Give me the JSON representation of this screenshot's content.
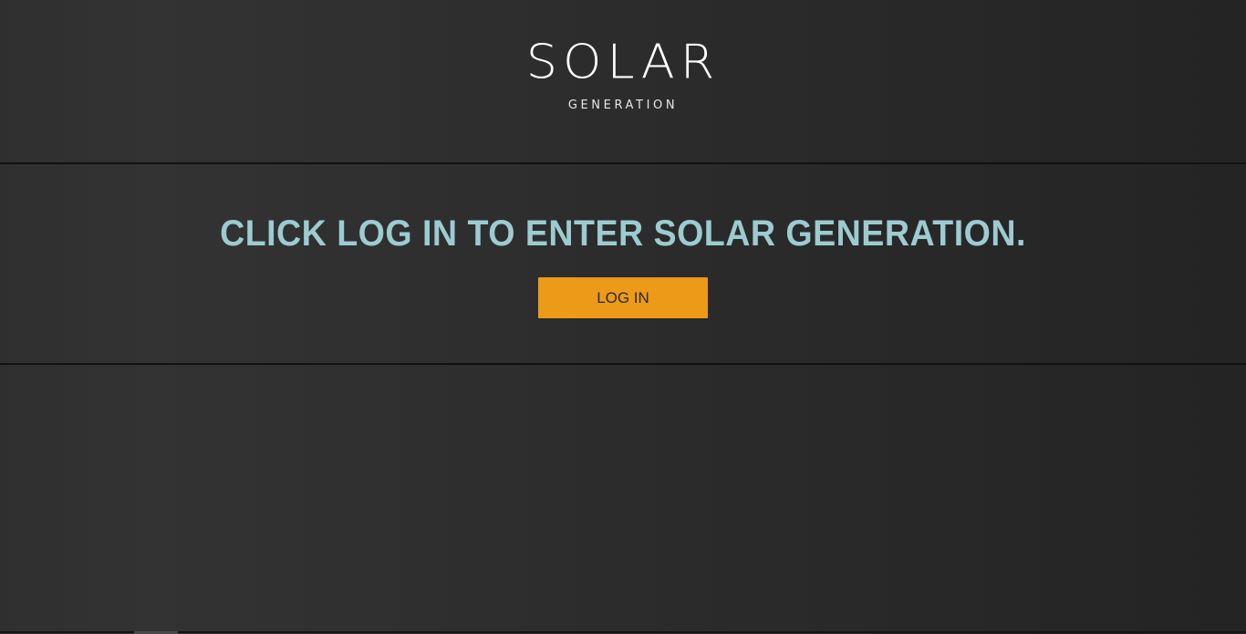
{
  "header": {
    "logo_main": "SOLAR",
    "logo_sub": "GENERATION"
  },
  "prompt": {
    "message": "CLICK LOG IN TO ENTER SOLAR GENERATION.",
    "login_label": "LOG IN"
  },
  "colors": {
    "accent": "#ec9a17",
    "prompt_text": "#9ccbd0",
    "background": "#2b2b2b"
  }
}
